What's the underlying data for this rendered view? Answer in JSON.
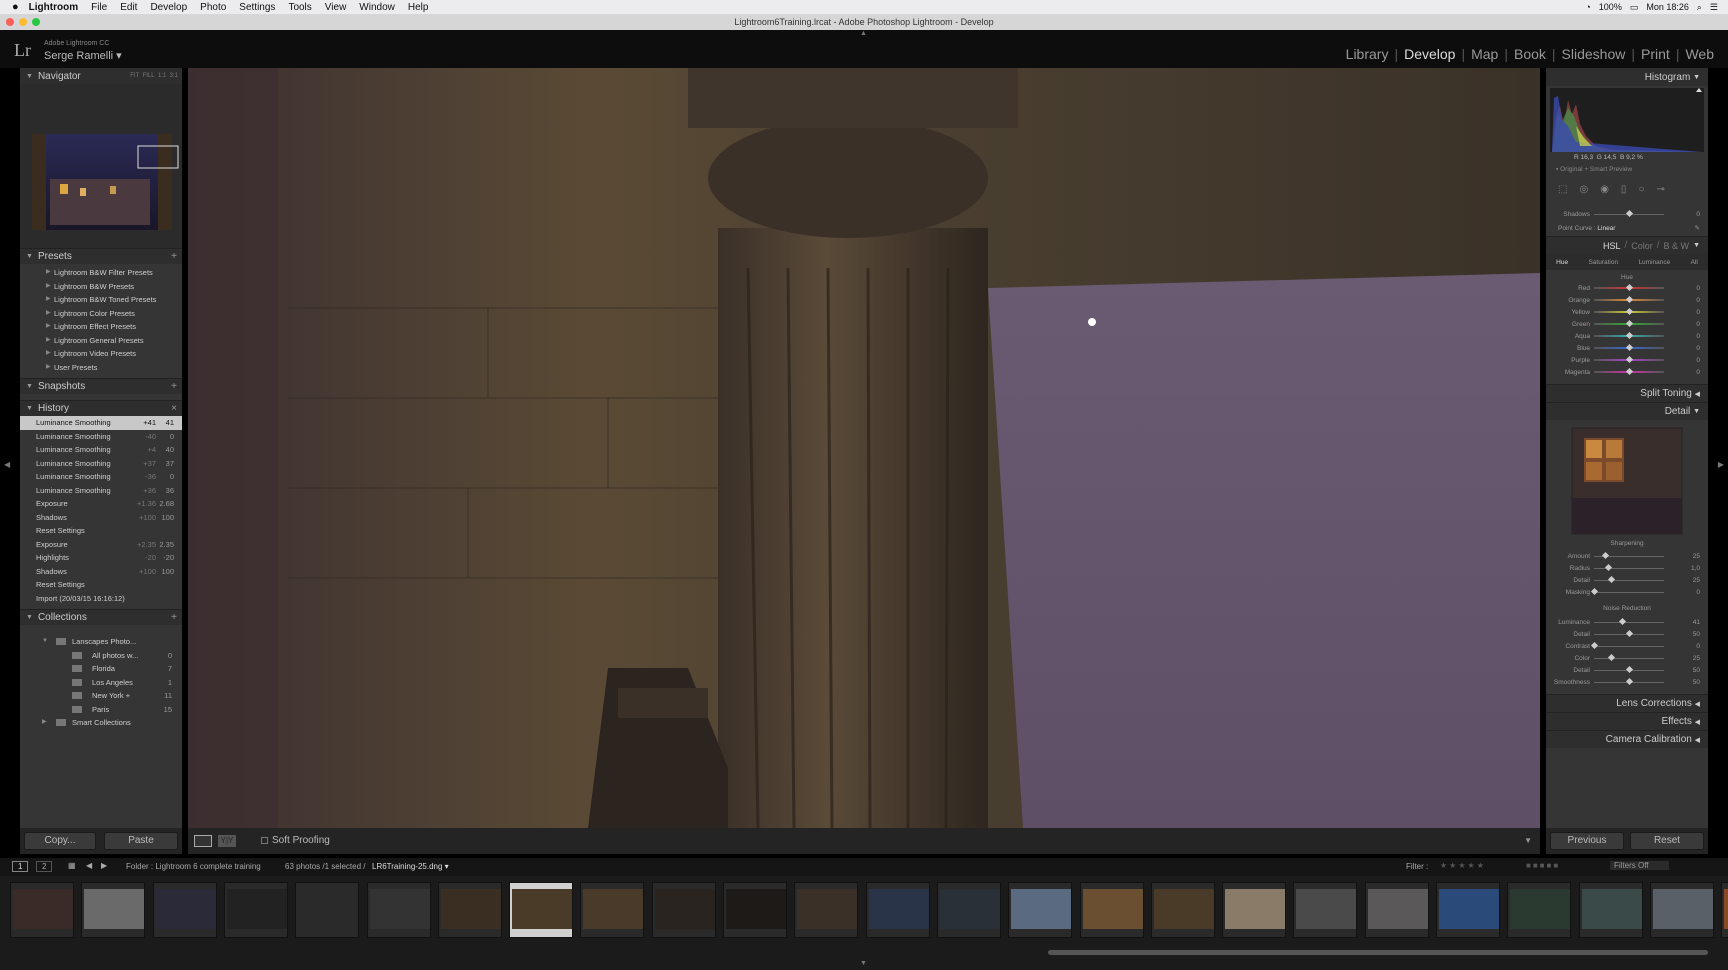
{
  "menubar": {
    "apple": "",
    "items": [
      "Lightroom",
      "File",
      "Edit",
      "Develop",
      "Photo",
      "Settings",
      "Tools",
      "View",
      "Window",
      "Help"
    ],
    "battery": "100%",
    "clock": "Mon 18:26"
  },
  "window": {
    "title": "Lightroom6Training.lrcat - Adobe Photoshop Lightroom - Develop"
  },
  "identity": {
    "logo": "Lr",
    "product": "Adobe Lightroom CC",
    "user": "Serge Ramelli ▾"
  },
  "modules": [
    "Library",
    "Develop",
    "Map",
    "Book",
    "Slideshow",
    "Print",
    "Web"
  ],
  "navigator": {
    "title": "Navigator",
    "zoom": [
      "FIT",
      "FILL",
      "1:1",
      "3:1"
    ]
  },
  "presets": {
    "title": "Presets",
    "items": [
      "Lightroom B&W Filter Presets",
      "Lightroom B&W Presets",
      "Lightroom B&W Toned Presets",
      "Lightroom Color Presets",
      "Lightroom Effect Presets",
      "Lightroom General Presets",
      "Lightroom Video Presets",
      "User Presets"
    ]
  },
  "snapshots": {
    "title": "Snapshots"
  },
  "history": {
    "title": "History",
    "items": [
      {
        "label": "Luminance Smoothing",
        "v1": "+41",
        "v2": "41"
      },
      {
        "label": "Luminance Smoothing",
        "v1": "-40",
        "v2": "0"
      },
      {
        "label": "Luminance Smoothing",
        "v1": "+4",
        "v2": "40"
      },
      {
        "label": "Luminance Smoothing",
        "v1": "+37",
        "v2": "37"
      },
      {
        "label": "Luminance Smoothing",
        "v1": "-36",
        "v2": "0"
      },
      {
        "label": "Luminance Smoothing",
        "v1": "+36",
        "v2": "36"
      },
      {
        "label": "Exposure",
        "v1": "+1.36",
        "v2": "2.68"
      },
      {
        "label": "Shadows",
        "v1": "+100",
        "v2": "100"
      },
      {
        "label": "Reset Settings",
        "v1": "",
        "v2": ""
      },
      {
        "label": "Exposure",
        "v1": "+2.35",
        "v2": "2.35"
      },
      {
        "label": "Highlights",
        "v1": "-20",
        "v2": "-20"
      },
      {
        "label": "Shadows",
        "v1": "+100",
        "v2": "100"
      },
      {
        "label": "Reset Settings",
        "v1": "",
        "v2": ""
      },
      {
        "label": "Import (20/03/15 16:16:12)",
        "v1": "",
        "v2": ""
      }
    ]
  },
  "collections": {
    "title": "Collections",
    "items": [
      {
        "label": "Lanscapes Photo...",
        "count": "",
        "level": 0
      },
      {
        "label": "All photos w...",
        "count": "0",
        "level": 1
      },
      {
        "label": "Florida",
        "count": "7",
        "level": 1
      },
      {
        "label": "Los Angeles",
        "count": "1",
        "level": 1
      },
      {
        "label": "New York +",
        "count": "11",
        "level": 1
      },
      {
        "label": "Paris",
        "count": "15",
        "level": 1
      },
      {
        "label": "Smart Collections",
        "count": "",
        "level": 0
      }
    ]
  },
  "left_buttons": {
    "copy": "Copy...",
    "paste": "Paste"
  },
  "toolbar": {
    "soft_proofing": "Soft Proofing"
  },
  "histogram": {
    "title": "Histogram",
    "r_label": "R",
    "r": "16,3",
    "g_label": "G",
    "g": "14,5",
    "b_label": "B",
    "b": "9,2",
    "unit": "%",
    "preview": "Original + Smart Preview"
  },
  "tone": {
    "shadows_label": "Shadows",
    "shadows_val": "0",
    "shadows": 0.5,
    "point_curve_label": "Point Curve :",
    "point_curve": "Linear"
  },
  "hsl": {
    "tabs": [
      "HSL",
      "Color",
      "B & W"
    ],
    "subtabs": [
      "Hue",
      "Saturation",
      "Luminance",
      "All"
    ],
    "section": "Hue",
    "sliders": [
      {
        "label": "Red",
        "value": "0",
        "pos": 0.5,
        "color": "#c33"
      },
      {
        "label": "Orange",
        "value": "0",
        "pos": 0.5,
        "color": "#d83"
      },
      {
        "label": "Yellow",
        "value": "0",
        "pos": 0.5,
        "color": "#cc3"
      },
      {
        "label": "Green",
        "value": "0",
        "pos": 0.5,
        "color": "#3a3"
      },
      {
        "label": "Aqua",
        "value": "0",
        "pos": 0.5,
        "color": "#3aa"
      },
      {
        "label": "Blue",
        "value": "0",
        "pos": 0.5,
        "color": "#36c"
      },
      {
        "label": "Purple",
        "value": "0",
        "pos": 0.5,
        "color": "#a4c"
      },
      {
        "label": "Magenta",
        "value": "0",
        "pos": 0.5,
        "color": "#c3a"
      }
    ]
  },
  "split_toning": {
    "title": "Split Toning"
  },
  "detail": {
    "title": "Detail",
    "sharpening_title": "Sharpening",
    "sharpening": [
      {
        "label": "Amount",
        "value": "25",
        "pos": 0.17
      },
      {
        "label": "Radius",
        "value": "1,0",
        "pos": 0.2
      },
      {
        "label": "Detail",
        "value": "25",
        "pos": 0.25
      },
      {
        "label": "Masking",
        "value": "0",
        "pos": 0.0
      }
    ],
    "nr_title": "Noise Reduction",
    "noise": [
      {
        "label": "Luminance",
        "value": "41",
        "pos": 0.41
      },
      {
        "label": "Detail",
        "value": "50",
        "pos": 0.5
      },
      {
        "label": "Contrast",
        "value": "0",
        "pos": 0.0
      },
      {
        "label": "Color",
        "value": "25",
        "pos": 0.25
      },
      {
        "label": "Detail",
        "value": "50",
        "pos": 0.5
      },
      {
        "label": "Smoothness",
        "value": "50",
        "pos": 0.5
      }
    ]
  },
  "lens_corrections": {
    "title": "Lens Corrections"
  },
  "effects": {
    "title": "Effects"
  },
  "camera_calibration": {
    "title": "Camera Calibration"
  },
  "right_buttons": {
    "previous": "Previous",
    "reset": "Reset"
  },
  "filmstrip_header": {
    "screen1": "1",
    "screen2": "2",
    "source": "Folder : Lightroom 6 complete training",
    "count": "63 photos /1 selected /",
    "file": "LR6Training-25.dng ▾",
    "filter_label": "Filter :",
    "filter_value": "Filters Off"
  },
  "colors": {
    "accent": "#d0d0d0",
    "panel": "#353535",
    "background": "#1b1b1b"
  }
}
